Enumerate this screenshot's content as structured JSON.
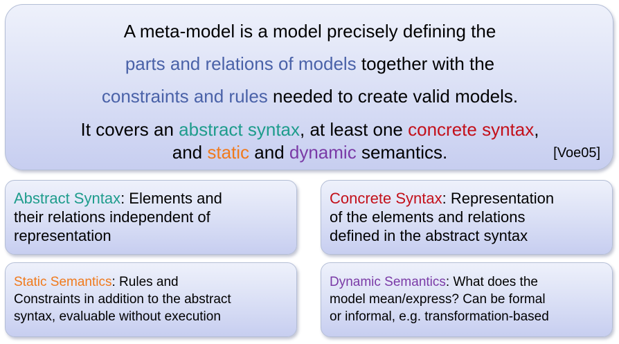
{
  "main": {
    "line1": "A meta-model is a model precisely defining the",
    "line2_highlight": "parts and relations of models",
    "line2_rest": " together with the",
    "line3_highlight": "constraints and rules",
    "line3_rest": " needed to create valid models.",
    "line4_a": "It covers an ",
    "line4_abstract": "abstract syntax",
    "line4_b": ", at least one ",
    "line4_concrete": "concrete syntax",
    "line4_c": ",",
    "line5_a": "and ",
    "line5_static": "static",
    "line5_b": " and ",
    "line5_dynamic": "dynamic",
    "line5_c": " semantics.",
    "citation": "[Voe05]"
  },
  "boxes": {
    "abstract": {
      "term": "Abstract Syntax",
      "line1_rest": ": Elements and",
      "line2": "their relations independent of",
      "line3": "representation"
    },
    "concrete": {
      "term": "Concrete Syntax",
      "line1_rest": ": Representation",
      "line2": "of the elements and relations",
      "line3": "defined in the abstract syntax"
    },
    "static": {
      "term": "Static Semantics",
      "line1_rest": ": Rules and",
      "line2": "Constraints in addition to the abstract",
      "line3": "syntax, evaluable without execution"
    },
    "dynamic": {
      "term": "Dynamic Semantics",
      "line1_rest": ": What does the",
      "line2": "model mean/express? Can be formal",
      "line3": "or informal, e.g. transformation-based"
    }
  },
  "colors": {
    "blue_highlight": "#4a62a8",
    "abstract": "#1e9c8c",
    "concrete": "#c3101a",
    "static": "#f07a1c",
    "dynamic": "#7a3aa6",
    "box_fill": "#d8def5"
  }
}
